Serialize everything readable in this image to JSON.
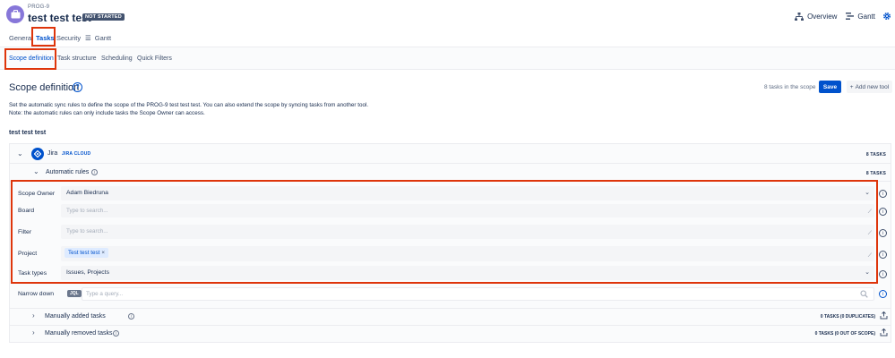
{
  "header": {
    "project_key": "PROG-9",
    "project_title": "test test test",
    "status_badge": "NOT STARTED",
    "overview_label": "Overview",
    "gantt_label": "Gantt"
  },
  "main_tabs": {
    "general": "General",
    "tasks": "Tasks",
    "security": "Security",
    "gantt": "Gantt"
  },
  "sub_tabs": {
    "scope_definition": "Scope definition",
    "task_structure": "Task structure",
    "scheduling": "Scheduling",
    "quick_filters": "Quick Filters"
  },
  "page": {
    "title": "Scope definition",
    "tasks_in_scope": "8 tasks in the scope",
    "save_label": "Save",
    "add_tool_label": "Add new tool",
    "description_line1": "Set the automatic sync rules to define the scope of the PROG-9 test test test. You can also extend the scope by syncing tasks from another tool.",
    "description_line2": "Note: the automatic rules can only include tasks the Scope Owner can access.",
    "section_name": "test test test"
  },
  "jira": {
    "name": "Jira",
    "cloud_badge": "JIRA CLOUD",
    "task_count": "8 TASKS",
    "automatic_rules_label": "Automatic rules",
    "automatic_rules_count": "8 TASKS"
  },
  "fields": {
    "scope_owner_label": "Scope Owner",
    "scope_owner_value": "Adam Biedruna",
    "board_label": "Board",
    "board_placeholder": "Type to search...",
    "filter_label": "Filter",
    "filter_placeholder": "Type to search...",
    "project_label": "Project",
    "project_tag": "Test test test",
    "task_types_label": "Task types",
    "task_types_value": "Issues, Projects"
  },
  "narrow": {
    "label": "Narrow down",
    "jql_badge": "JQL",
    "query_placeholder": "Type a query..."
  },
  "manual": {
    "added_label": "Manually added tasks",
    "added_count": "0 TASKS (0 DUPLICATES)",
    "removed_label": "Manually removed tasks",
    "removed_count": "0 TASKS (0 OUT OF SCOPE)"
  },
  "colors": {
    "accent": "#0052cc",
    "highlight": "#de350b",
    "avatar": "#8777d9"
  }
}
